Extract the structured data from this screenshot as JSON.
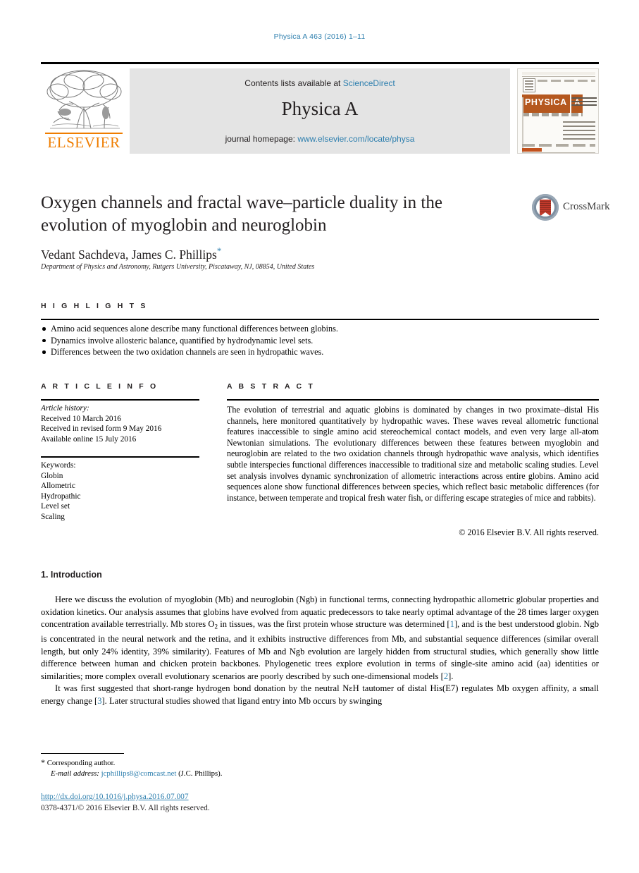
{
  "running_head": "Physica A 463 (2016) 1–11",
  "masthead": {
    "contents_prefix": "Contents lists available at ",
    "contents_link": "ScienceDirect",
    "journal_name": "Physica A",
    "homepage_prefix": "journal homepage: ",
    "homepage_link": "www.elsevier.com/locate/physa",
    "publisher_wordmark": "ELSEVIER",
    "publisher_logo_icon": "elsevier-tree-icon",
    "cover_title": "PHYSICA",
    "cover_volume": "A",
    "cover_subtitle": "STATISTICAL MECHANICS AND ITS APPLICATIONS"
  },
  "article": {
    "title": "Oxygen channels and fractal wave–particle duality in the evolution of myoglobin and neuroglobin",
    "authors": "Vedant Sachdeva, James C. Phillips",
    "corresponding_marker": "*",
    "affiliation": "Department of Physics and Astronomy, Rutgers University, Piscataway, NJ, 08854, United States",
    "crossmark_label": "CrossMark",
    "crossmark_icon": "crossmark-badge-icon"
  },
  "highlights": {
    "heading": "H I G H L I G H T S",
    "items": [
      "Amino acid sequences alone describe many functional differences between globins.",
      "Dynamics involve allosteric balance, quantified by hydrodynamic level sets.",
      "Differences between the two oxidation channels are seen in hydropathic waves."
    ]
  },
  "article_info": {
    "heading": "A R T I C L E    I N F O",
    "history_label": "Article history:",
    "history": [
      "Received 10 March 2016",
      "Received in revised form 9 May 2016",
      "Available online 15 July 2016"
    ],
    "keywords_label": "Keywords:",
    "keywords": [
      "Globin",
      "Allometric",
      "Hydropathic",
      "Level set",
      "Scaling"
    ]
  },
  "abstract": {
    "heading": "A B S T R A C T",
    "text": "The evolution of terrestrial and aquatic globins is dominated by changes in two proximate–distal His channels, here monitored quantitatively by hydropathic waves. These waves reveal allometric functional features inaccessible to single amino acid stereochemical contact models, and even very large all-atom Newtonian simulations. The evolutionary differences between these features between myoglobin and neuroglobin are related to the two oxidation channels through hydropathic wave analysis, which identifies subtle interspecies functional differences inaccessible to traditional size and metabolic scaling studies. Level set analysis involves dynamic synchronization of allometric interactions across entire globins. Amino acid sequences alone show functional differences between species, which reflect basic metabolic differences (for instance, between temperate and tropical fresh water fish, or differing escape strategies of mice and rabbits).",
    "copyright": "© 2016 Elsevier B.V. All rights reserved."
  },
  "introduction": {
    "heading": "1. Introduction",
    "paragraph_1_a": "Here we discuss the evolution of myoglobin (Mb) and neuroglobin (Ngb) in functional terms, connecting hydropathic allometric globular properties and oxidation kinetics. Our analysis assumes that globins have evolved from aquatic predecessors to take nearly optimal advantage of the 28 times larger oxygen concentration available terrestrially. Mb stores O",
    "paragraph_1_sub": "2",
    "paragraph_1_b": " in tissues, was the first protein whose structure was determined [",
    "ref_1": "1",
    "paragraph_1_c": "], and is the best understood globin. Ngb is concentrated in the neural network and the retina, and it exhibits instructive differences from Mb, and substantial sequence differences (similar overall length, but only 24% identity, 39% similarity). Features of Mb and Ngb evolution are largely hidden from structural studies, which generally show little difference between human and chicken protein backbones. Phylogenetic trees explore evolution in terms of single-site amino acid (aa) identities or similarities; more complex overall evolutionary scenarios are poorly described by such one-dimensional models [",
    "ref_2": "2",
    "paragraph_1_d": "].",
    "paragraph_2_a": "It was first suggested that short-range hydrogen bond donation by the neutral NεH tautomer of distal His(E7) regulates Mb oxygen affinity, a small energy change [",
    "ref_3": "3",
    "paragraph_2_b": "]. Later structural studies showed that ligand entry into Mb occurs by swinging"
  },
  "footer": {
    "corresponding_marker": "*",
    "corresponding_text": "Corresponding author.",
    "email_label": "E-mail address:",
    "email": "jcphillips8@comcast.net",
    "email_owner": "(J.C. Phillips).",
    "doi": "http://dx.doi.org/10.1016/j.physa.2016.07.007",
    "issn_line": "0378-4371/© 2016 Elsevier B.V. All rights reserved."
  },
  "colors": {
    "link": "#2e7fae",
    "elsevier_orange": "#ef7d00",
    "band_gray": "#e4e4e4",
    "cover_brown": "#b5581f",
    "crossmark_red": "#c0392b",
    "crossmark_blue": "#7e8fa0"
  }
}
